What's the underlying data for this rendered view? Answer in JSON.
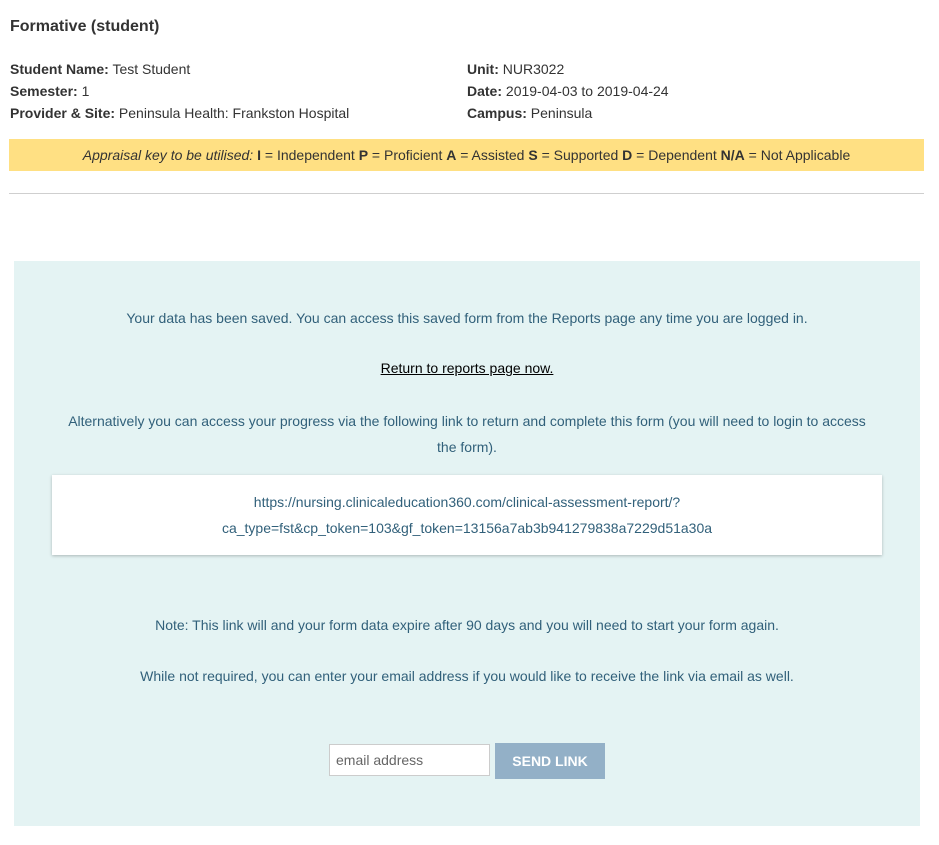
{
  "page_title": "Formative (student)",
  "student": {
    "name_label": "Student Name:",
    "name_value": "Test Student",
    "semester_label": "Semester:",
    "semester_value": "1",
    "provider_label": "Provider & Site:",
    "provider_value": "Peninsula Health: Frankston Hospital"
  },
  "unit": {
    "unit_label": "Unit:",
    "unit_value": "NUR3022",
    "date_label": "Date:",
    "date_value": "2019-04-03 to 2019-04-24",
    "campus_label": "Campus:",
    "campus_value": "Peninsula"
  },
  "appraisal": {
    "intro": "Appraisal key to be utilised:",
    "keys": [
      {
        "code": "I",
        "text": "= Independent"
      },
      {
        "code": "P",
        "text": "= Proficient"
      },
      {
        "code": "A",
        "text": "= Assisted"
      },
      {
        "code": "S",
        "text": "= Supported"
      },
      {
        "code": "D",
        "text": "= Dependent"
      },
      {
        "code": "N/A",
        "text": "= Not Applicable"
      }
    ]
  },
  "saved_panel": {
    "saved_message": "Your data has been saved. You can access this saved form from the Reports page any time you are logged in.",
    "return_link": "Return to reports page now.",
    "alternative_line1": "Alternatively you can access your progress via the following link to return and complete this form (you will need to login to access",
    "alternative_line2": "the form).",
    "url_line1": "https://nursing.clinicaleducation360.com/clinical-assessment-report/?",
    "url_line2": "ca_type=fst&cp_token=103&gf_token=13156a7ab3b941279838a7229d51a30a",
    "note": "Note: This link will and your form data expire after 90 days and you will need to start your form again.",
    "email_prompt": "While not required, you can enter your email address if you would like to receive the link via email as well.",
    "email_placeholder": "email address",
    "send_button": "SEND LINK"
  },
  "colors": {
    "appraisal_bg": "#ffe083",
    "panel_bg": "#e4f3f3",
    "panel_text": "#31607a",
    "send_button_bg": "#93b0c7"
  }
}
